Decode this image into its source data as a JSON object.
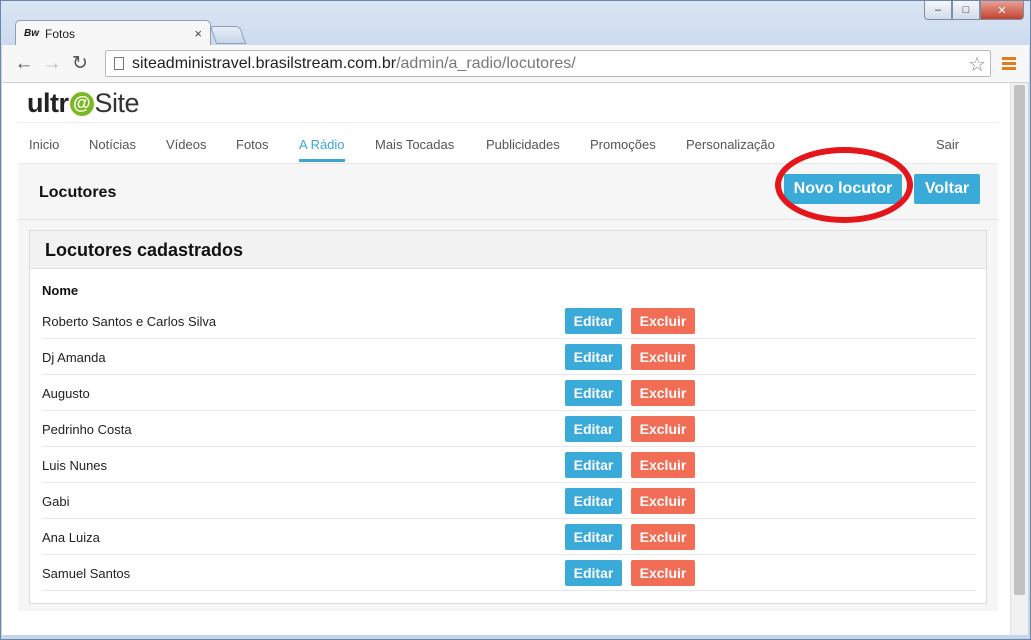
{
  "browser": {
    "tab_favicon": "Bw",
    "tab_title": "Fotos",
    "tab_close": "×",
    "url_host": "siteadministravel.brasilstream.com.br",
    "url_path": "/admin/a_radio/locutores/",
    "back": "←",
    "forward": "→",
    "reload": "↻",
    "star": "☆",
    "window_min": "‒",
    "window_max": "□",
    "window_close": "✕"
  },
  "logo": {
    "part1": "ultr",
    "at": "@",
    "part2": "Site",
    "accent_color": "#7bb823"
  },
  "nav": {
    "items": [
      "Inicio",
      "Notícias",
      "Vídeos",
      "Fotos",
      "A Rádio",
      "Mais Tocadas",
      "Publicidades",
      "Promoções",
      "Personalização"
    ],
    "active": "A Rádio",
    "logout": "Sair",
    "accent_color": "#3aa6d4"
  },
  "header": {
    "title": "Locutores",
    "new_button": "Novo locutor",
    "back_button": "Voltar",
    "highlight_color": "#e4151b"
  },
  "card": {
    "title": "Locutores cadastrados",
    "column_name": "Nome",
    "edit_label": "Editar",
    "delete_label": "Excluir",
    "edit_color": "#3aaad8",
    "delete_color": "#f26d55",
    "rows": [
      "Roberto Santos e Carlos Silva",
      "Dj Amanda",
      "Augusto",
      "Pedrinho Costa",
      "Luis Nunes",
      "Gabi",
      "Ana Luiza",
      "Samuel Santos"
    ]
  }
}
